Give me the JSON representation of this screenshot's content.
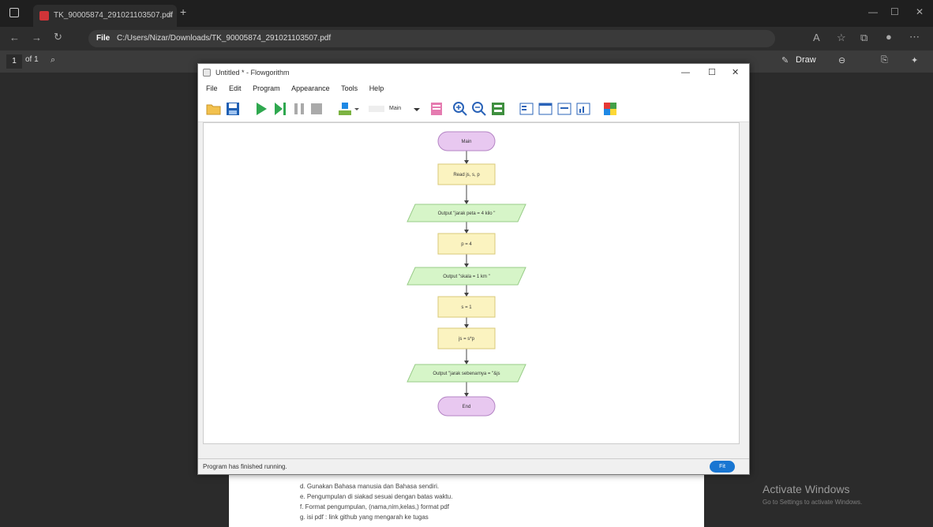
{
  "browser": {
    "tab_title": "TK_90005874_291021103507.pdf",
    "new_tab": "+",
    "address_scheme": "File",
    "address_path": "C:/Users/Nizar/Downloads/TK_90005874_291021103507.pdf",
    "win_min": "—",
    "win_max": "☐",
    "win_close": "✕"
  },
  "pdf_toolbar": {
    "page_number": "1",
    "page_count": "of 1",
    "draw_label": "Draw"
  },
  "flowgorithm": {
    "title": "Untitled * - Flowgorithm",
    "min": "—",
    "max": "☐",
    "close": "✕",
    "menu": [
      "File",
      "Edit",
      "Program",
      "Appearance",
      "Tools",
      "Help"
    ],
    "function_select": "Main",
    "status": "Program has finished running.",
    "zoom_label": "Fit",
    "flow": [
      {
        "type": "terminal",
        "text": "Main"
      },
      {
        "type": "process",
        "text": "Read js, s, p"
      },
      {
        "type": "io",
        "text": "Output \"jarak peta = 4 kilo \""
      },
      {
        "type": "process",
        "text": "p = 4"
      },
      {
        "type": "io",
        "text": "Output \"skala = 1 km \""
      },
      {
        "type": "process",
        "text": "s = 1"
      },
      {
        "type": "process",
        "text": "js = s*p"
      },
      {
        "type": "io",
        "text": "Output \"jarak sebenarnya = \"&js"
      },
      {
        "type": "terminal",
        "text": "End"
      }
    ]
  },
  "pdf_page": {
    "lines": [
      "d.   Gunakan Bahasa manusia dan Bahasa sendiri.",
      "e.   Pengumpulan di siakad sesuai dengan batas waktu.",
      "f.    Format pengumpulan, (nama,nim,kelas,) format pdf",
      "g.   isi pdf : link github yang mengarah ke tugas"
    ]
  },
  "windows_watermark": {
    "title": "Activate Windows",
    "subtitle": "Go to Settings to activate Windows."
  },
  "colors": {
    "terminal_fill": "#e8c8f0",
    "process_fill": "#fbf3c0",
    "io_fill": "#d6f5c8"
  }
}
